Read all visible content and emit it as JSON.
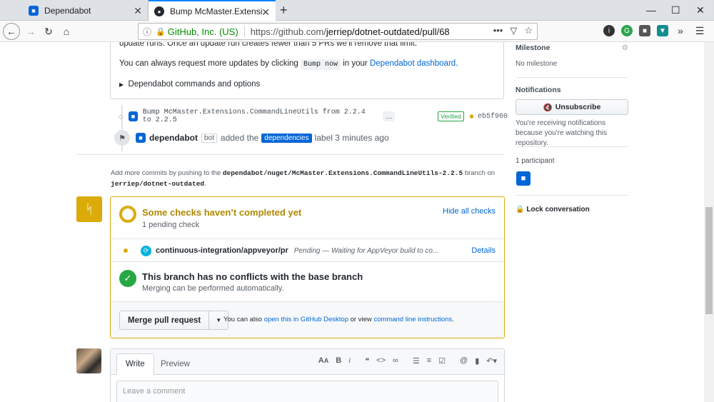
{
  "browser": {
    "tabs": [
      {
        "title": "Dependabot"
      },
      {
        "title": "Bump McMaster.Extensions.Co"
      }
    ],
    "new_tab": "+",
    "url_identity": "GitHub, Inc. (US)",
    "url_prefix": "https://github.com/",
    "url_path": "jerriep/dotnet-outdated/pull/68",
    "url_more": "•••"
  },
  "pr": {
    "body_text_top": "update runs. Once an update run creates fewer than 5 PRs we'll remove that limit.",
    "request_prefix": "You can always request more updates by clicking",
    "bump_code": "Bump now",
    "request_middle": "in your",
    "dashboard_link": "Dependabot dashboard",
    "request_end": ".",
    "commands_summary": "Dependabot commands and options",
    "commit_message": "Bump McMaster.Extensions.CommandLineUtils from 2.2.4 to 2.2.5",
    "commit_more": "…",
    "verified": "Verified",
    "commit_sha": "eb5f960",
    "label_actor": "dependabot",
    "label_bot": "bot",
    "label_added": "added the",
    "label_name": "dependencies",
    "label_time": "label 3 minutes ago",
    "add_commits_prefix": "Add more commits by pushing to the",
    "branch": "dependabot/nuget/McMaster.Extensions.CommandLineUtils-2.2.5",
    "add_commits_mid": "branch on",
    "repo": "jerriep/dotnet-outdated",
    "add_commits_end": "."
  },
  "merge": {
    "status_title": "Some checks haven’t completed yet",
    "status_sub": "1 pending check",
    "hide_checks": "Hide all checks",
    "check_name": "continuous-integration/appveyor/pr",
    "check_status": "Pending — Waiting for AppVeyor build to co...",
    "check_details": "Details",
    "no_conflict_title": "This branch has no conflicts with the base branch",
    "no_conflict_sub": "Merging can be performed automatically.",
    "merge_button": "Merge pull request",
    "note_prefix": "You can also",
    "note_link1": "open this in GitHub Desktop",
    "note_mid": "or view",
    "note_link2": "command line instructions",
    "note_end": "."
  },
  "comment": {
    "tab_write": "Write",
    "tab_preview": "Preview",
    "placeholder": "Leave a comment"
  },
  "sidebar": {
    "milestone_heading": "Milestone",
    "milestone_value": "No milestone",
    "notifications_heading": "Notifications",
    "unsubscribe": "Unsubscribe",
    "notif_text": "You're receiving notifications because you're watching this repository.",
    "participants": "1 participant",
    "lock": "Lock conversation"
  }
}
